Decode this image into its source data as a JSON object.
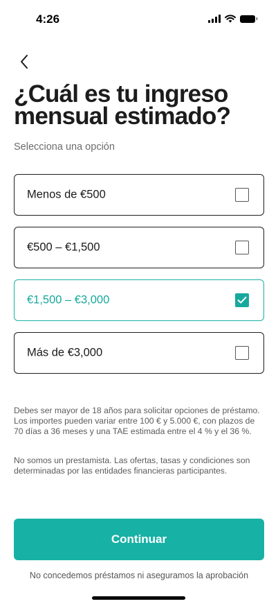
{
  "status_bar": {
    "time": "4:26"
  },
  "header": {
    "title": "¿Cuál es tu ingreso mensual estimado?",
    "subtitle": "Selecciona una opción"
  },
  "options": [
    {
      "label": "Menos de €500",
      "selected": false
    },
    {
      "label": "€500 – €1,500",
      "selected": false
    },
    {
      "label": "€1,500 – €3,000",
      "selected": true
    },
    {
      "label": "Más de €3,000",
      "selected": false
    }
  ],
  "disclaimer": {
    "paragraph_1": "Debes ser mayor de 18 años para solicitar opciones de préstamo. Los importes pueden variar entre 100 € y 5.000 €, con plazos de 70 días a 36 meses y una TAE estimada entre el 4 % y el 36 %.",
    "paragraph_2": "No somos un prestamista. Las ofertas, tasas y condiciones son determinadas por las entidades financieras participantes."
  },
  "cta": {
    "label": "Continuar"
  },
  "footnote": "No concedemos préstamos ni aseguramos la aprobación",
  "colors": {
    "accent": "#18b1a6",
    "text": "#1a1a1a",
    "muted": "#6b6b6b"
  },
  "icons": {
    "back": "chevron-left-icon",
    "check": "checkmark-icon"
  }
}
